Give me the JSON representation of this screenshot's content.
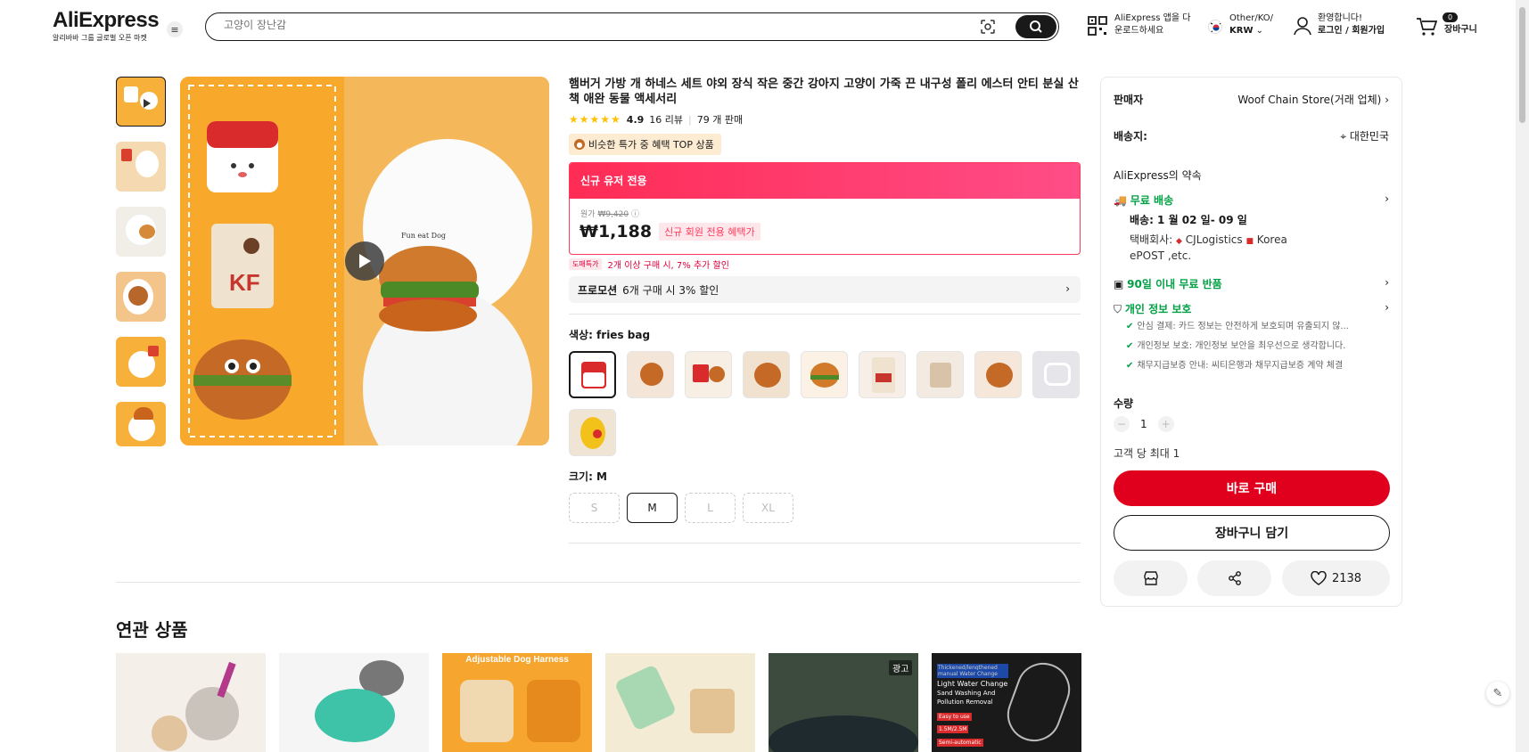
{
  "header": {
    "logo": "AliExpress",
    "logo_sub": "알리바바 그룹 글로벌 오픈 마켓",
    "search_placeholder": "고양이 장난감",
    "app_line1": "AliExpress 앱을 다",
    "app_line2": "운로드하세요",
    "lang_line1": "Other/KO/",
    "lang_line2": "KRW",
    "account_line1": "환영합니다!",
    "account_line2": "로그인 / 회원가입",
    "cart_count": "0",
    "cart_label": "장바구니"
  },
  "product": {
    "title": "햄버거 가방 개 하네스 세트 야외 장식 작은 중간 강아지 고양이 가죽 끈 내구성 폴리 에스터 안티 분실 산책 애완 동물 액세서리",
    "stars": "★★★★★",
    "rating": "4.9",
    "reviews": "16 리뷰",
    "sold": "79 개 판매",
    "top_tag": "비슷한 특가 중 혜택 TOP 상품",
    "new_user_label": "신규 유저 전용",
    "orig_label": "원가",
    "orig_price": "₩9,420",
    "price": "₩1,188",
    "benefit": "신규 회원 전용 혜택가",
    "wholesale_tag": "도매특가",
    "wholesale_text": "2개 이상 구매 시, 7% 추가 할인",
    "promo_label": "프로모션",
    "promo_text": "6개 구매 시 3% 할인",
    "color_label": "색상: fries bag",
    "size_label": "크기: M",
    "sizes": [
      "S",
      "M",
      "L",
      "XL"
    ]
  },
  "side": {
    "seller_label": "판매자",
    "seller_name": "Woof Chain Store(거래 업체)",
    "ship_label": "배송지:",
    "ship_to": "대한민국",
    "promise": "AliExpress의 약속",
    "free_ship": "무료 배송",
    "delivery": "배송: 1 월 02 일- 09 일",
    "courier_label": "택배회사:",
    "courier1": "CJLogistics",
    "courier2": "Korea",
    "courier3": "ePOST ,etc.",
    "free_return": "90일 이내 무료 반품",
    "privacy": "개인 정보 보호",
    "check1": "안심 결제: 카드 정보는 안전하게 보호되며 유출되지 않...",
    "check2": "개인정보 보호: 개인정보 보안을 최우선으로 생각합니다.",
    "check3": "채무지급보증 안내: 씨티은행과 채무지급보증 계약 체결",
    "qty_label": "수량",
    "qty": "1",
    "max_qty": "고객 당 최대 1",
    "buy_now": "바로 구매",
    "add_cart": "장바구니 담기",
    "likes": "2138"
  },
  "related": {
    "title": "연관 상품",
    "ad_badge": "광고",
    "item3_banner": "Adjustable Dog Harness",
    "item6_lines": [
      "Thickened/lengthened",
      "manual Water Change",
      "Light Water Change",
      "Sand Washing And",
      "Pollution Removal",
      "Easy to use",
      "1.5M/2.5M",
      "Semi-automatic"
    ]
  }
}
